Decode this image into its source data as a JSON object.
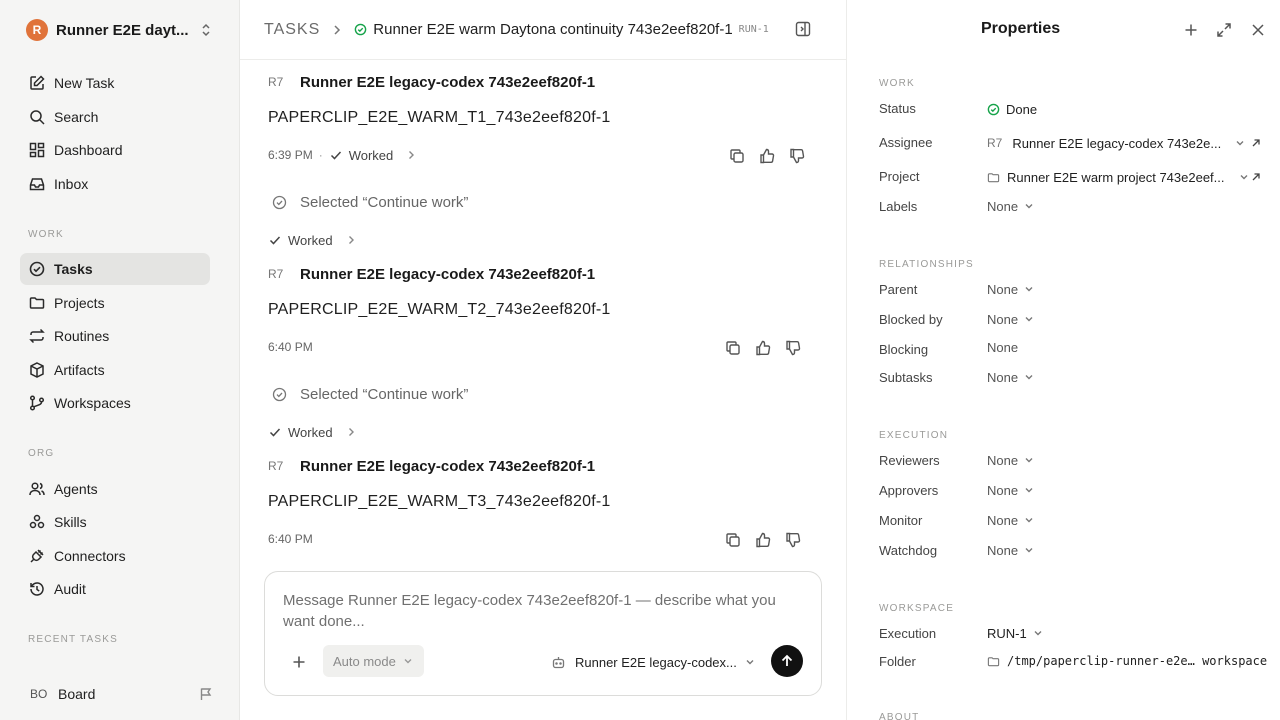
{
  "sidebar": {
    "workspace": {
      "logo": "R",
      "name": "Runner E2E dayt..."
    },
    "nav": [
      {
        "label": "New Task",
        "icon": "pencil-square-icon"
      },
      {
        "label": "Search",
        "icon": "search-icon"
      },
      {
        "label": "Dashboard",
        "icon": "grid-icon"
      },
      {
        "label": "Inbox",
        "icon": "inbox-icon"
      }
    ],
    "work_section": "WORK",
    "work": [
      {
        "label": "Tasks",
        "icon": "circle-check-icon",
        "active": true
      },
      {
        "label": "Projects",
        "icon": "folder-icon"
      },
      {
        "label": "Routines",
        "icon": "repeat-icon"
      },
      {
        "label": "Artifacts",
        "icon": "box-icon"
      },
      {
        "label": "Workspaces",
        "icon": "git-branch-icon"
      }
    ],
    "org_section": "ORG",
    "org": [
      {
        "label": "Agents",
        "icon": "users-icon"
      },
      {
        "label": "Skills",
        "icon": "molecule-icon"
      },
      {
        "label": "Connectors",
        "icon": "plug-icon"
      },
      {
        "label": "Audit",
        "icon": "history-icon"
      }
    ],
    "recent_section": "RECENT TASKS",
    "board": {
      "avatar": "BO",
      "name": "Board"
    }
  },
  "header": {
    "root": "TASKS",
    "title": "Runner E2E warm Daytona continuity 743e2eef820f-1",
    "id": "RUN-1"
  },
  "feed": {
    "messages": [
      {
        "badge": "R7",
        "author": "Runner E2E legacy-codex 743e2eef820f-1",
        "body": "PAPERCLIP_E2E_WARM_T1_743e2eef820f-1",
        "time": "6:39 PM",
        "dot": "·",
        "status": "Worked"
      },
      {
        "badge": "R7",
        "author": "Runner E2E legacy-codex 743e2eef820f-1",
        "body": "PAPERCLIP_E2E_WARM_T2_743e2eef820f-1",
        "time": "6:40 PM"
      },
      {
        "badge": "R7",
        "author": "Runner E2E legacy-codex 743e2eef820f-1",
        "body": "PAPERCLIP_E2E_WARM_T3_743e2eef820f-1",
        "time": "6:40 PM"
      }
    ],
    "selections": [
      {
        "text": "Selected “Continue work”",
        "worked": "Worked"
      },
      {
        "text": "Selected “Continue work”",
        "worked": "Worked"
      }
    ]
  },
  "composer": {
    "placeholder": "Message Runner E2E legacy-codex 743e2eef820f-1 — describe what you want done...",
    "mode": "Auto mode",
    "agent": "Runner E2E legacy-codex..."
  },
  "properties": {
    "title": "Properties",
    "work_section": "WORK",
    "status_label": "Status",
    "status": "Done",
    "assignee_label": "Assignee",
    "assignee_badge": "R7",
    "assignee": "Runner E2E legacy-codex 743e2e...",
    "project_label": "Project",
    "project": "Runner E2E warm project 743e2eef...",
    "labels_label": "Labels",
    "labels": "None",
    "rel_section": "RELATIONSHIPS",
    "parent_label": "Parent",
    "parent": "None",
    "blocked_by_label": "Blocked by",
    "blocked_by": "None",
    "blocking_label": "Blocking",
    "blocking": "None",
    "subtasks_label": "Subtasks",
    "subtasks": "None",
    "exec_section": "EXECUTION",
    "reviewers_label": "Reviewers",
    "reviewers": "None",
    "approvers_label": "Approvers",
    "approvers": "None",
    "monitor_label": "Monitor",
    "monitor": "None",
    "watchdog_label": "Watchdog",
    "watchdog": "None",
    "ws_section": "WORKSPACE",
    "execution_label": "Execution",
    "execution": "RUN-1",
    "folder_label": "Folder",
    "folder": "/tmp/paperclip-runner-e2e… workspace",
    "about_section": "ABOUT"
  },
  "colors": {
    "accent_green": "#16a34a",
    "logo_orange": "#e0733a",
    "active_nav": "#e4e4e2"
  }
}
